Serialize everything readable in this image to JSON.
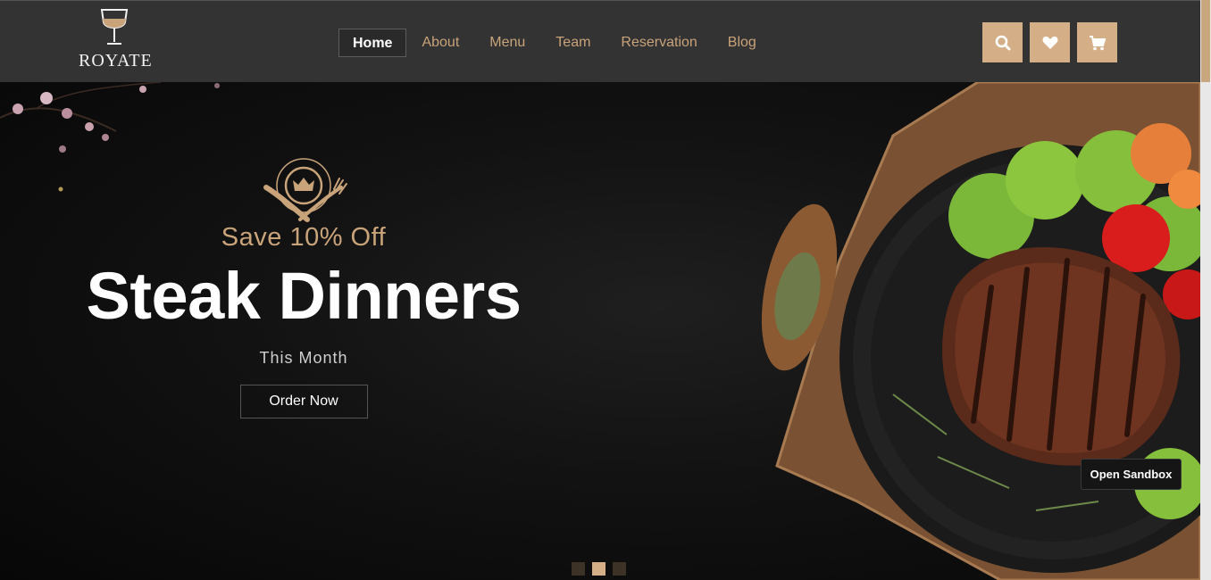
{
  "brand": {
    "name": "ROYATE"
  },
  "nav": {
    "items": [
      {
        "label": "Home",
        "active": true
      },
      {
        "label": "About",
        "active": false
      },
      {
        "label": "Menu",
        "active": false
      },
      {
        "label": "Team",
        "active": false
      },
      {
        "label": "Reservation",
        "active": false
      },
      {
        "label": "Blog",
        "active": false
      }
    ]
  },
  "header_icons": [
    "search-icon",
    "heart-icon",
    "cart-icon"
  ],
  "hero": {
    "offer": "Save 10% Off",
    "headline": "Steak Dinners",
    "subline": "This Month",
    "cta_label": "Order Now"
  },
  "slider": {
    "slides": 3,
    "active_index": 1
  },
  "sandbox": {
    "label": "Open Sandbox"
  },
  "colors": {
    "accent": "#d3ae86",
    "header_bg": "#333333",
    "hero_bg": "#0b0b0b"
  }
}
